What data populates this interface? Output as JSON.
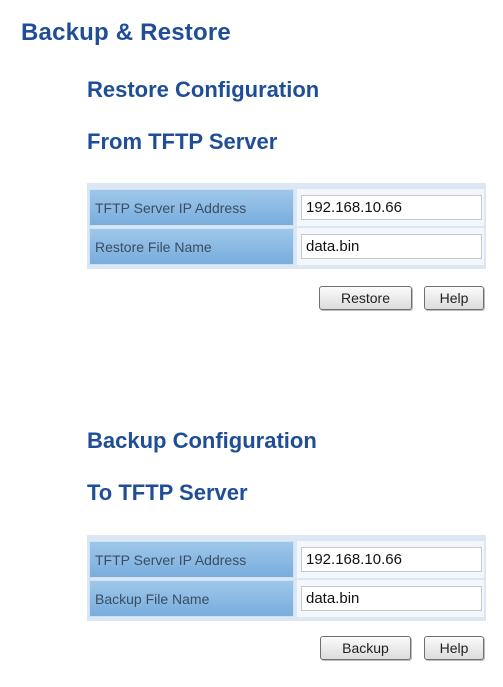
{
  "page": {
    "title": "Backup & Restore"
  },
  "restore": {
    "heading_line1": "Restore Configuration",
    "heading_line2": "From TFTP Server",
    "ip_label": "TFTP Server IP Address",
    "ip_value": "192.168.10.66",
    "file_label": "Restore File Name",
    "file_value": "data.bin",
    "action_label": "Restore",
    "help_label": "Help"
  },
  "backup": {
    "heading_line1": "Backup Configuration",
    "heading_line2": "To TFTP Server",
    "ip_label": "TFTP Server IP Address",
    "ip_value": "192.168.10.66",
    "file_label": "Backup File Name",
    "file_value": "data.bin",
    "action_label": "Backup",
    "help_label": "Help"
  }
}
